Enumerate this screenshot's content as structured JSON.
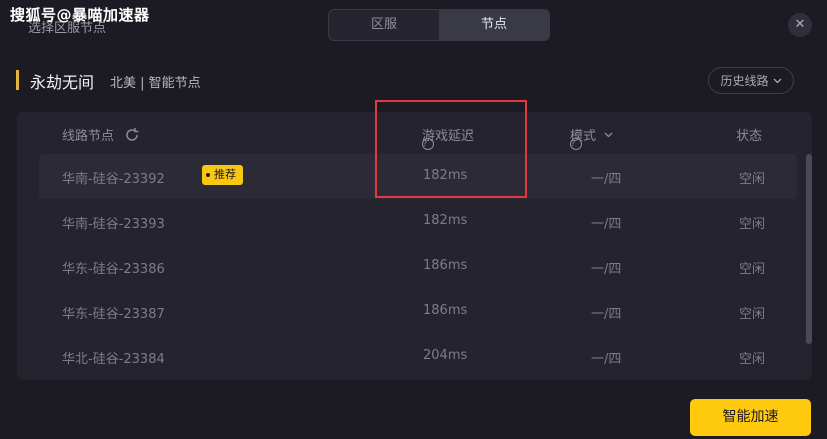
{
  "watermark": "搜狐号@暴喵加速器",
  "under_title": "选择区服节点",
  "tabs": [
    {
      "label": "区服",
      "active": false
    },
    {
      "label": "节点",
      "active": true
    }
  ],
  "close_icon": "close-icon",
  "game": {
    "title": "永劫无间",
    "region": "北美 | 智能节点"
  },
  "history_button": {
    "label": "历史线路",
    "icon": "chevron-down-icon"
  },
  "table": {
    "headers": {
      "name": "线路节点",
      "latency": "游戏延迟",
      "mode": "模式",
      "status": "状态"
    },
    "rows": [
      {
        "name": "华南-硅谷-23392",
        "badge": "推荐",
        "latency": "182ms",
        "mode": "一/四",
        "status": "空闲"
      },
      {
        "name": "华南-硅谷-23393",
        "latency": "182ms",
        "mode": "一/四",
        "status": "空闲"
      },
      {
        "name": "华东-硅谷-23386",
        "latency": "186ms",
        "mode": "一/四",
        "status": "空闲"
      },
      {
        "name": "华东-硅谷-23387",
        "latency": "186ms",
        "mode": "一/四",
        "status": "空闲"
      },
      {
        "name": "华北-硅谷-23384",
        "latency": "204ms",
        "mode": "一/四",
        "status": "空闲"
      }
    ]
  },
  "accelerate_button": "智能加速",
  "colors": {
    "accent": "#ffc90e",
    "background": "#1c1b24",
    "highlight_box": "#e0393e"
  }
}
